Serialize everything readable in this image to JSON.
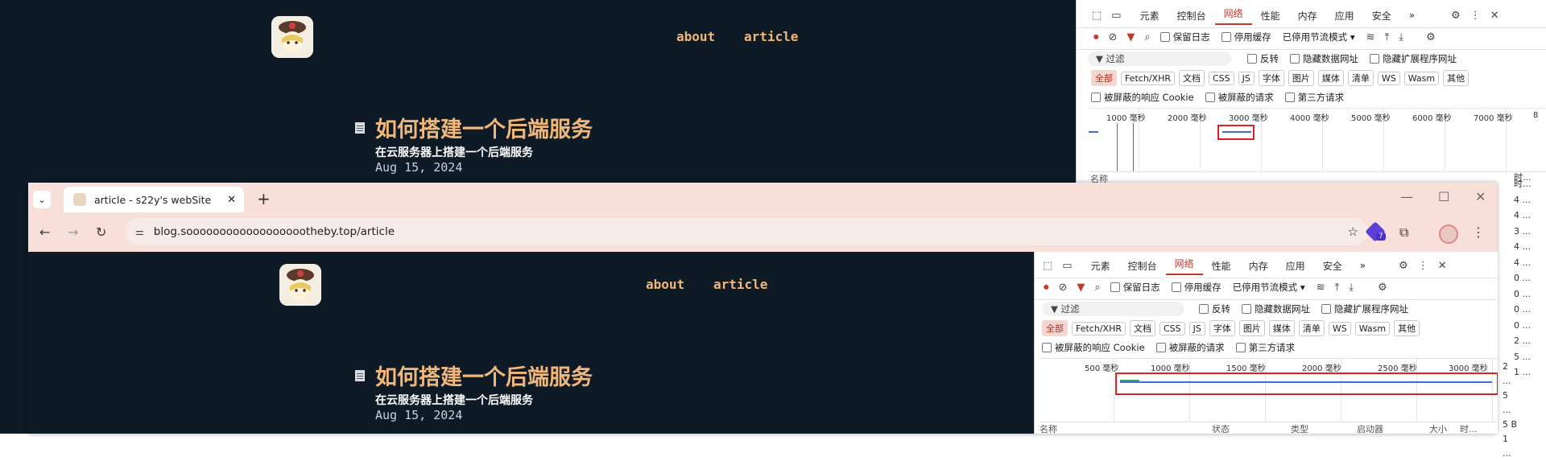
{
  "site": {
    "nav": {
      "about": "about",
      "article": "article"
    },
    "post": {
      "title": "如何搭建一个后端服务",
      "subtitle": "在云服务器上搭建一个后端服务",
      "date": "Aug 15, 2024"
    }
  },
  "browser": {
    "tab_title": "article - s22y's webSite",
    "new_tab": "+",
    "url": "blog.sooooooooooooooooootheby.top/article",
    "extension_badge": "7"
  },
  "devtools": {
    "tabs": [
      "元素",
      "控制台",
      "网络",
      "性能",
      "内存",
      "应用",
      "安全"
    ],
    "active_tab": "网络",
    "more_tabs": "»",
    "preserve_log": "保留日志",
    "disable_cache": "停用缓存",
    "throttle": "已停用节流模式",
    "filter_placeholder": "过滤",
    "invert": "反转",
    "hide_data_urls": "隐藏数据网址",
    "hide_extension_urls": "隐藏扩展程序网址",
    "type_filters": [
      "全部",
      "Fetch/XHR",
      "文档",
      "CSS",
      "JS",
      "字体",
      "图片",
      "媒体",
      "清单",
      "WS",
      "Wasm",
      "其他"
    ],
    "blocked_cookies": "被屏蔽的响应 Cookie",
    "blocked_requests": "被屏蔽的请求",
    "third_party": "第三方请求",
    "overview_ticks_top": [
      "1000 毫秒",
      "2000 毫秒",
      "3000 毫秒",
      "4000 毫秒",
      "5000 毫秒",
      "6000 毫秒",
      "7000 毫秒",
      "8"
    ],
    "overview_ticks_bottom": [
      "500 毫秒",
      "1000 毫秒",
      "1500 毫秒",
      "2000 毫秒",
      "2500 毫秒",
      "3000 毫秒"
    ],
    "table_headers": [
      "名称",
      "状态",
      "类型",
      "启动器",
      "大小",
      "时..."
    ],
    "top_time_col": [
      "时...",
      "4 ...",
      "4 ...",
      "3 ...",
      "4 ...",
      "4 ...",
      "0 ...",
      "0 ...",
      "0 ...",
      "0 ...",
      "2 ...",
      "5 ...",
      "1 ..."
    ],
    "bottom_time_col": [
      "2 ...",
      "5 ...",
      "5 B",
      "1 ..."
    ]
  },
  "colors": {
    "site_bg": "#0e1a26",
    "accent": "#f0b77a",
    "network_tab": "#c0392b",
    "highlight": "#e02020",
    "browser_frame": "#f9dfd9"
  }
}
